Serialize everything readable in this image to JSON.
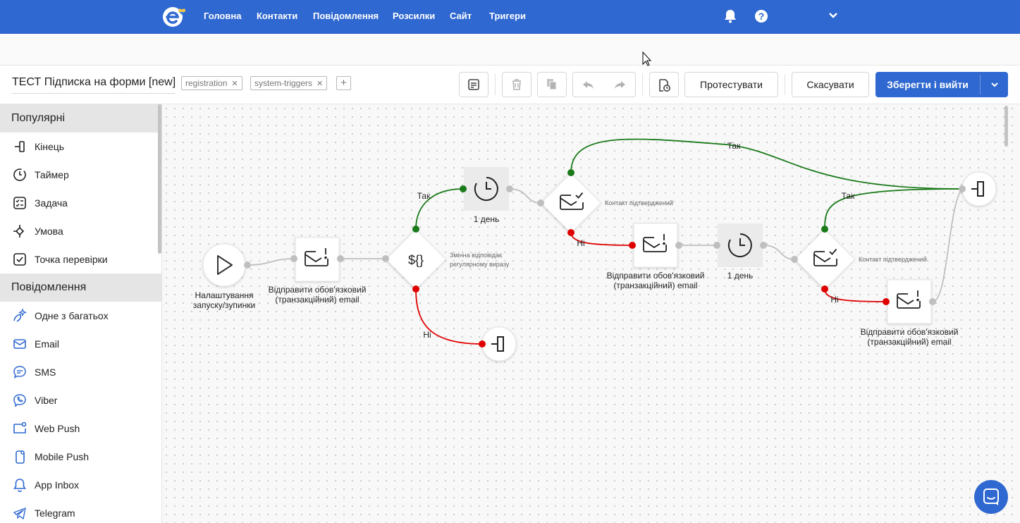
{
  "nav": {
    "items": [
      "Головна",
      "Контакти",
      "Повідомлення",
      "Розсилки",
      "Сайт",
      "Тригери"
    ]
  },
  "header": {
    "title": "ТЕСТ Підписка на форми [new]",
    "tags": [
      "registration",
      "system-triggers"
    ],
    "test_label": "Протестувати",
    "cancel_label": "Скасувати",
    "save_label": "Зберегти і вийти"
  },
  "sidebar": {
    "popular_title": "Популярні",
    "popular": [
      {
        "label": "Кінець",
        "icon": "end-icon"
      },
      {
        "label": "Таймер",
        "icon": "timer-icon"
      },
      {
        "label": "Задача",
        "icon": "task-icon"
      },
      {
        "label": "Умова",
        "icon": "condition-icon"
      },
      {
        "label": "Точка перевірки",
        "icon": "checkpoint-icon"
      }
    ],
    "messages_title": "Повідомлення",
    "messages": [
      {
        "label": "Одне з багатьох",
        "icon": "sparkle-icon"
      },
      {
        "label": "Email",
        "icon": "email-icon"
      },
      {
        "label": "SMS",
        "icon": "sms-icon"
      },
      {
        "label": "Viber",
        "icon": "viber-icon"
      },
      {
        "label": "Web Push",
        "icon": "web-push-icon"
      },
      {
        "label": "Mobile Push",
        "icon": "mobile-push-icon"
      },
      {
        "label": "App Inbox",
        "icon": "bell-icon"
      },
      {
        "label": "Telegram",
        "icon": "telegram-icon"
      }
    ]
  },
  "flow": {
    "start_label_1": "Налаштування",
    "start_label_2": "запуску/зупинки",
    "email_label_1": "Відправити обов'язковий",
    "email_label_2": "(транзакційний) email",
    "regex_label_1": "Змінна відповідає",
    "regex_label_2": "регулярному виразу",
    "regex_symbol": "${}",
    "timer_label": "1 день",
    "confirmed_label": "Контакт підтверджений",
    "yes": "Так",
    "no": "Ні"
  },
  "colors": {
    "brand": "#2f68d0",
    "yes_line": "#1a7a1a",
    "no_line": "#e00000"
  }
}
